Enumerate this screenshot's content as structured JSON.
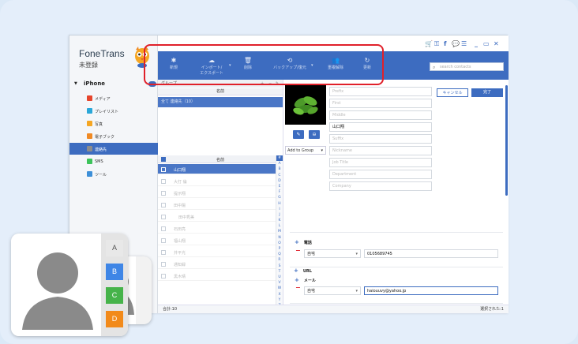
{
  "app": {
    "name": "FoneTrans",
    "status": "未登録"
  },
  "device": {
    "name": "iPhone"
  },
  "sidebar": {
    "items": [
      {
        "label": "メディア",
        "icon": "media-icon",
        "color": "#e6452c"
      },
      {
        "label": "プレイリスト",
        "icon": "playlist-icon",
        "color": "#2aa7d8"
      },
      {
        "label": "写真",
        "icon": "photos-icon",
        "color": "#f5a623"
      },
      {
        "label": "電子ブック",
        "icon": "ebook-icon",
        "color": "#f08a24"
      },
      {
        "label": "連絡先",
        "icon": "contacts-icon",
        "color": "#8c8c8c"
      },
      {
        "label": "SMS",
        "icon": "sms-icon",
        "color": "#3cc35a"
      },
      {
        "label": "ツール",
        "icon": "toolbox-icon",
        "color": "#3d8fd8"
      }
    ]
  },
  "toolbar": {
    "new_label": "新規",
    "import_export_label_1": "インポート/",
    "import_export_label_2": "エクスポート",
    "delete_label": "削除",
    "backup_label": "バックアップ/復元",
    "dedupe_label": "重複解除",
    "refresh_label": "更新"
  },
  "search": {
    "placeholder": "search contacts"
  },
  "groups": {
    "header": "グループ",
    "column": "名前",
    "all": "全て 連絡先（10）"
  },
  "contacts": {
    "column": "名前",
    "rows": [
      "山口翔",
      "大打 倫",
      "提示翔",
      "田中陽",
      "田中秀美",
      "石田亮",
      "福山翔",
      "井平光",
      "通知録",
      "黒木晴"
    ],
    "selected_index": 0
  },
  "alphabet": [
    "#",
    "A",
    "B",
    "C",
    "D",
    "E",
    "F",
    "G",
    "H",
    "I",
    "J",
    "K",
    "L",
    "M",
    "N",
    "O",
    "P",
    "Q",
    "R",
    "S",
    "T",
    "U",
    "V",
    "W",
    "X",
    "Y",
    "Z",
    "#"
  ],
  "footer": {
    "total": "合計:10",
    "selected": "選択された:1"
  },
  "detail": {
    "cancel_label": "キャンセル",
    "done_label": "完了",
    "add_group_label": "Add to Group",
    "fields": [
      {
        "placeholder": "Prefix",
        "value": ""
      },
      {
        "placeholder": "First",
        "value": ""
      },
      {
        "placeholder": "Middle",
        "value": ""
      },
      {
        "placeholder": "",
        "value": "山口翔"
      },
      {
        "placeholder": "Suffix",
        "value": ""
      },
      {
        "placeholder": "Nickname",
        "value": ""
      },
      {
        "placeholder": "Job Title",
        "value": ""
      },
      {
        "placeholder": "Department",
        "value": ""
      },
      {
        "placeholder": "Company",
        "value": ""
      }
    ],
    "phone": {
      "title": "電話",
      "type": "自宅",
      "value": "0105689745"
    },
    "email": {
      "title": "メール",
      "type": "自宅",
      "value": "haiouuvy@yahoo.jp"
    },
    "url": {
      "title": "URL"
    }
  },
  "contacts_icon_tabs": [
    "A",
    "B",
    "C",
    "D"
  ],
  "colors": {
    "accent": "#3d6cc0",
    "highlight": "#e0202a"
  }
}
